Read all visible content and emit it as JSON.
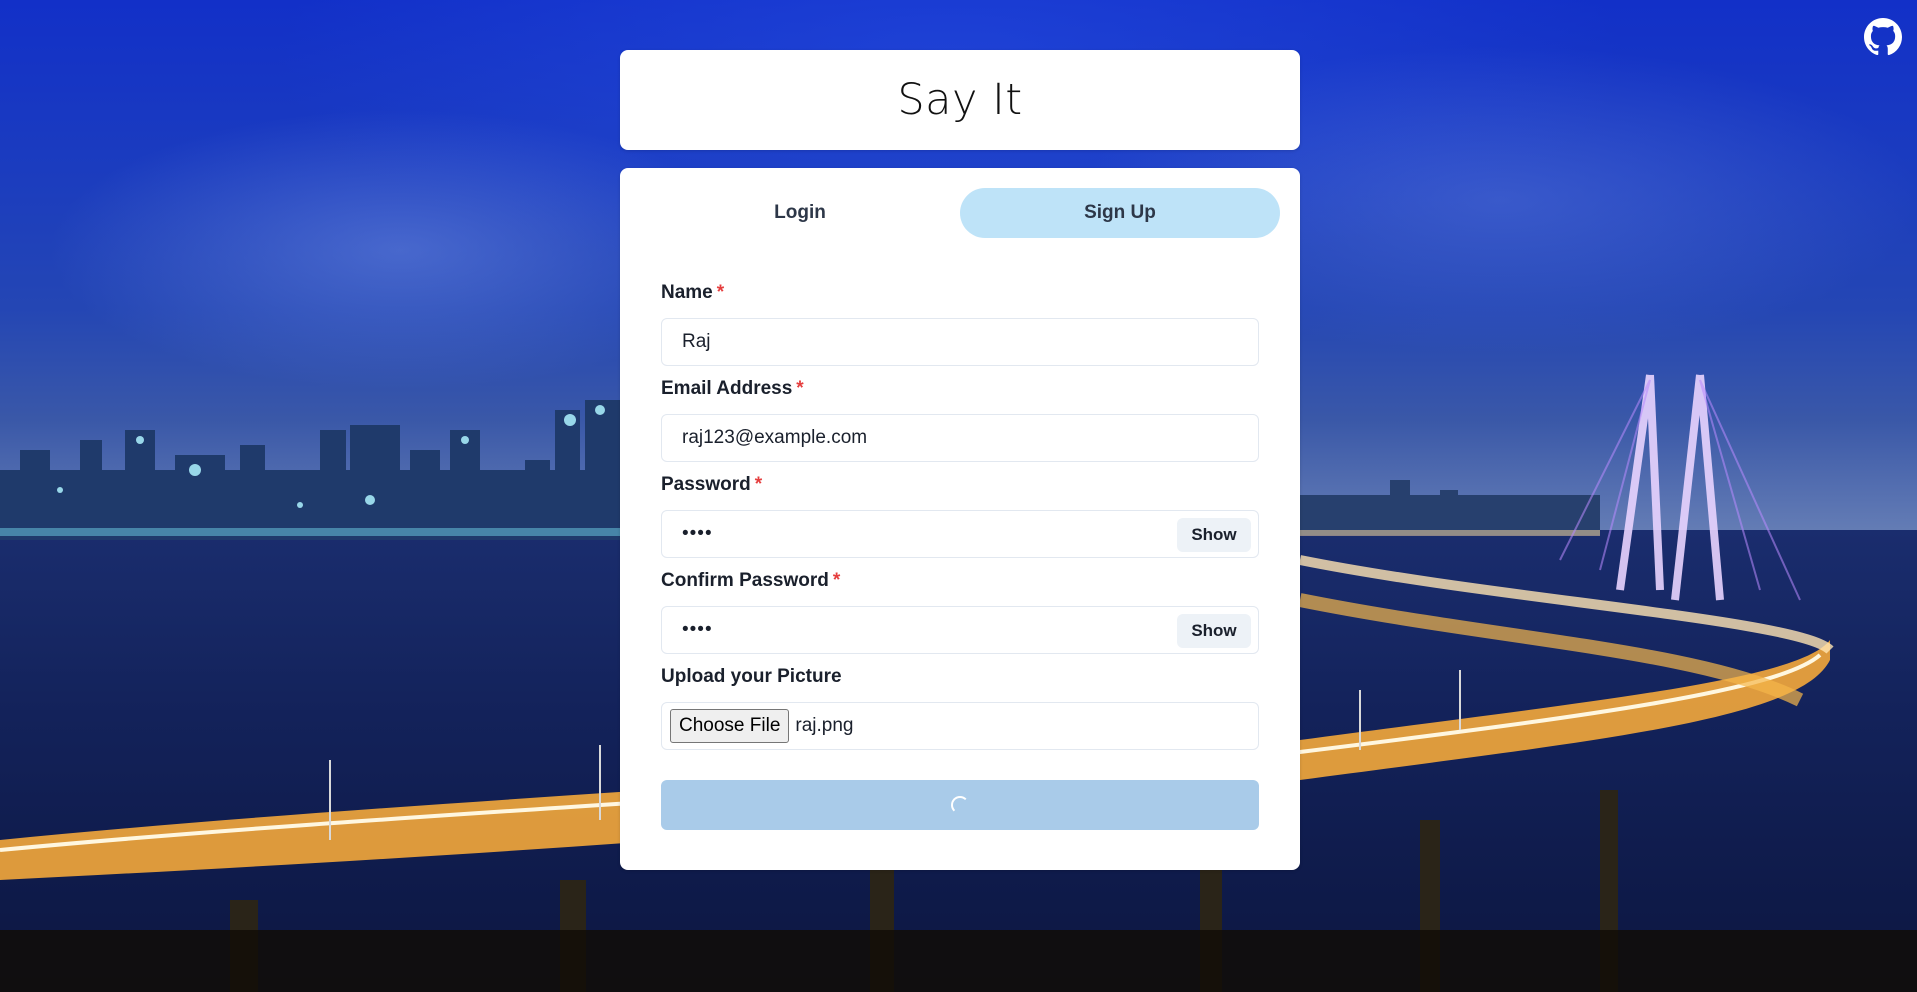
{
  "app": {
    "title": "Say It"
  },
  "tabs": [
    {
      "label": "Login",
      "active": false
    },
    {
      "label": "Sign Up",
      "active": true
    }
  ],
  "form": {
    "name": {
      "label": "Name",
      "required_mark": "*",
      "value": "Raj"
    },
    "email": {
      "label": "Email Address",
      "required_mark": "*",
      "value": "raj123@example.com"
    },
    "password": {
      "label": "Password",
      "required_mark": "*",
      "value": "••••",
      "toggle_label": "Show"
    },
    "confirm_password": {
      "label": "Confirm Password",
      "required_mark": "*",
      "value": "••••",
      "toggle_label": "Show"
    },
    "picture": {
      "label": "Upload your Picture",
      "button_label": "Choose File",
      "file_name": "raj.png"
    },
    "submit": {
      "state": "loading",
      "icon": "spinner-icon"
    }
  },
  "links": {
    "github_icon": "github-icon"
  },
  "colors": {
    "tab_active_bg": "#bee3f8",
    "submit_bg": "#a9cbe9",
    "required": "#e53e3e"
  }
}
